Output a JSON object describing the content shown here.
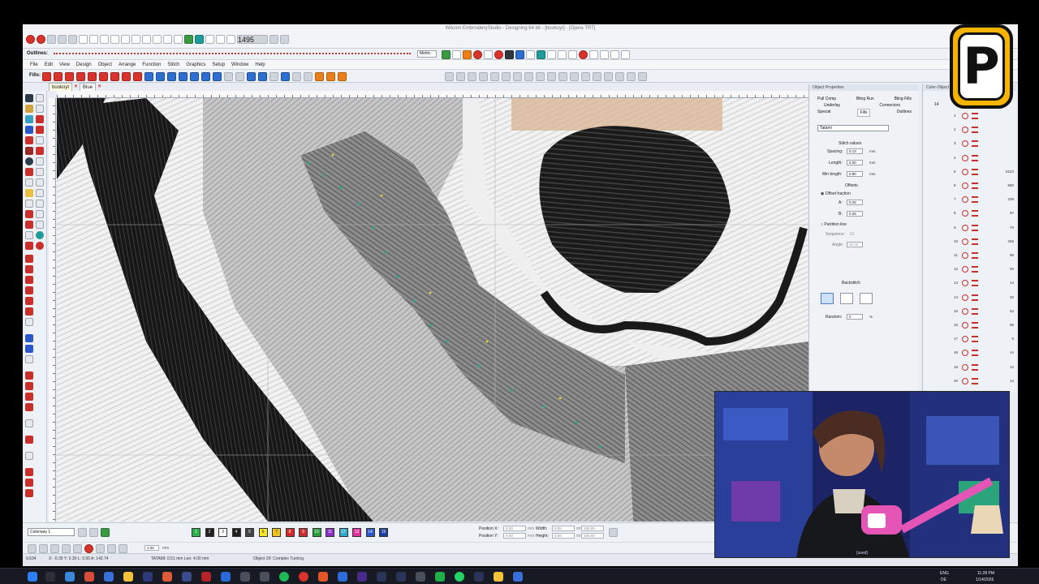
{
  "app": {
    "title": "Wilcom EmbroideryStudio - Designing 64 bit - [bookoyt] - [Gjena TRT]",
    "outlines_label": "Outlines:",
    "fills_label": "Fills:",
    "style_value": "1495",
    "units_value": "Metric"
  },
  "menu": [
    "File",
    "Edit",
    "View",
    "Design",
    "Object",
    "Arrange",
    "Function",
    "Stitch",
    "Graphics",
    "Setup",
    "Window",
    "Help"
  ],
  "tabs": [
    {
      "label": "bookoyt",
      "active": true
    },
    {
      "label": "Blue",
      "active": false
    }
  ],
  "object_properties": {
    "title": "Object Properties",
    "tabs_row1": [
      "Pull Comp",
      "Bling Run",
      "Bling Fills"
    ],
    "tabs_row2": [
      "Underlay",
      "Connectors"
    ],
    "tabs_row3": [
      "Special",
      "Fills",
      "Outlines"
    ],
    "fill_type": "Tatami",
    "stitch_values_label": "Stitch values",
    "spacing_label": "Spacing:",
    "spacing_value": "0.13",
    "length_label": "Length:",
    "length_value": "4.00",
    "min_length_label": "Min length:",
    "min_length_value": "0.80",
    "unit_mm": "mm",
    "offsets_label": "Offsets",
    "offset_fraction_label": "Offset fraction",
    "a_label": "A:",
    "a_value": "0.25",
    "b_label": "B:",
    "b_value": "0.25",
    "partition_label": "Partition line",
    "sequence_label": "Sequence:",
    "sequence_value": "01",
    "angle_label": "Angle:",
    "angle_value": "90.00",
    "backstitch_label": "Backstitch",
    "random_label": "Random:",
    "random_value": "0",
    "percent": "%"
  },
  "color_object_list": {
    "title": "Color-Object List",
    "header_count": "14",
    "rows": [
      {
        "n": "1",
        "count": ""
      },
      {
        "n": "2",
        "count": ""
      },
      {
        "n": "3",
        "count": ""
      },
      {
        "n": "4",
        "count": ""
      },
      {
        "n": "5",
        "count": "6223"
      },
      {
        "n": "6",
        "count": "980"
      },
      {
        "n": "7",
        "count": "239"
      },
      {
        "n": "8",
        "count": "97"
      },
      {
        "n": "9",
        "count": "70"
      },
      {
        "n": "10",
        "count": "265"
      },
      {
        "n": "11",
        "count": "96"
      },
      {
        "n": "12",
        "count": "30"
      },
      {
        "n": "13",
        "count": "14"
      },
      {
        "n": "14",
        "count": "30"
      },
      {
        "n": "15",
        "count": "53"
      },
      {
        "n": "16",
        "count": "65"
      },
      {
        "n": "17",
        "count": "5"
      },
      {
        "n": "18",
        "count": "14"
      },
      {
        "n": "19",
        "count": "14"
      },
      {
        "n": "20",
        "count": "14"
      }
    ]
  },
  "bottom": {
    "colorway": "Colorway 1",
    "chips": [
      {
        "label": "1",
        "color": "#2bb24c"
      },
      {
        "label": "2",
        "color": "#222222"
      },
      {
        "label": "3",
        "color": "#ffffff"
      },
      {
        "label": "4",
        "color": "#1f1f1f"
      },
      {
        "label": "5",
        "color": "#444444"
      },
      {
        "label": "6",
        "color": "#f7e626"
      },
      {
        "label": "7",
        "color": "#f0c21e"
      },
      {
        "label": "8",
        "color": "#d42a2a"
      },
      {
        "label": "9",
        "color": "#c9302c"
      },
      {
        "label": "10",
        "color": "#2a9d3a"
      },
      {
        "label": "11",
        "color": "#8b2fc9"
      },
      {
        "label": "12",
        "color": "#2fa7c9"
      },
      {
        "label": "13",
        "color": "#e22ea0"
      },
      {
        "label": "14",
        "color": "#2a58c9"
      },
      {
        "label": "15",
        "color": "#1a3fa1"
      }
    ],
    "position_x_label": "Position X:",
    "position_y_label": "Position Y:",
    "pos_x_value": "0.00",
    "pos_y_value": "0.00",
    "width_label": "Width:",
    "height_label": "Height:",
    "width_value": "0.00",
    "height_value": "0.00",
    "pct_w": "100.00",
    "pct_h": "100.00",
    "zoom_value": "1.00",
    "unit_mm": "mm"
  },
  "status": {
    "coords": "X: -0.39 Y: 0.30 L: 0.50 A: 142.74",
    "stitch_info": "TATAMI: 0.51 mm Len: 4.00 mm",
    "object_info": "Object 29: Complex Turning",
    "left_value": "9,634"
  },
  "webcam": {
    "caption": "[used]"
  },
  "logo": {
    "letter": "P"
  },
  "taskbar": {
    "lang": "ENG",
    "region": "DE",
    "time": "11:28 PM",
    "date": "1/14/2026"
  }
}
